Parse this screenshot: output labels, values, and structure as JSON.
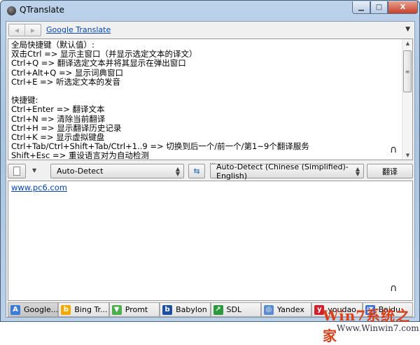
{
  "window": {
    "title": "QTranslate",
    "min": "▁",
    "max": "□",
    "close": "X"
  },
  "toolbar": {
    "back": "◀",
    "forward": "▶",
    "service": "Google Translate",
    "menu": "▼"
  },
  "output": {
    "lines": [
      "全局快捷键（默认值）:",
      "双击Ctrl => 显示主窗口（并显示选定文本的译文）",
      "Ctrl+Q => 翻译选定文本并将其显示在弹出窗口",
      "Ctrl+Alt+Q => 显示词典窗口",
      "Ctrl+E => 听选定文本的发音",
      "",
      "快捷键:",
      "Ctrl+Enter => 翻译文本",
      "Ctrl+N => 清除当前翻译",
      "Ctrl+H => 显示翻译历史记录",
      "Ctrl+K => 显示虚拟键盘",
      "Ctrl+Tab/Ctrl+Shift+Tab/Ctrl+1..9 => 切换到后一个/前一个/第1~9个翻译服务",
      "Shift+Esc => 重设语言对为自动检测"
    ]
  },
  "controls": {
    "source_lang": "Auto-Detect",
    "swap": "⇆",
    "target_lang": "Auto-Detect (Chinese (Simplified)-English)",
    "translate": "翻译",
    "dots": "..."
  },
  "input": {
    "value": "www.pc6.com"
  },
  "tabs": [
    {
      "label": "Google...",
      "color": "#3b7bd8",
      "glyph": "A"
    },
    {
      "label": "Bing Tr...",
      "color": "#f5a800",
      "glyph": "b"
    },
    {
      "label": "Promt",
      "color": "#4cae4c",
      "glyph": "▼"
    },
    {
      "label": "Babylon",
      "color": "#1f4fa0",
      "glyph": "b"
    },
    {
      "label": "SDL",
      "color": "#2a9a3c",
      "glyph": "↗"
    },
    {
      "label": "Yandex",
      "color": "#5a8ad0",
      "glyph": "◎"
    },
    {
      "label": "youdao",
      "color": "#d0202a",
      "glyph": "y"
    },
    {
      "label": "Baidu",
      "color": "#3a6fd0",
      "glyph": "译"
    }
  ],
  "watermark": {
    "line1": "Win7系统之家",
    "line2": "Www.Winwin7.com"
  }
}
